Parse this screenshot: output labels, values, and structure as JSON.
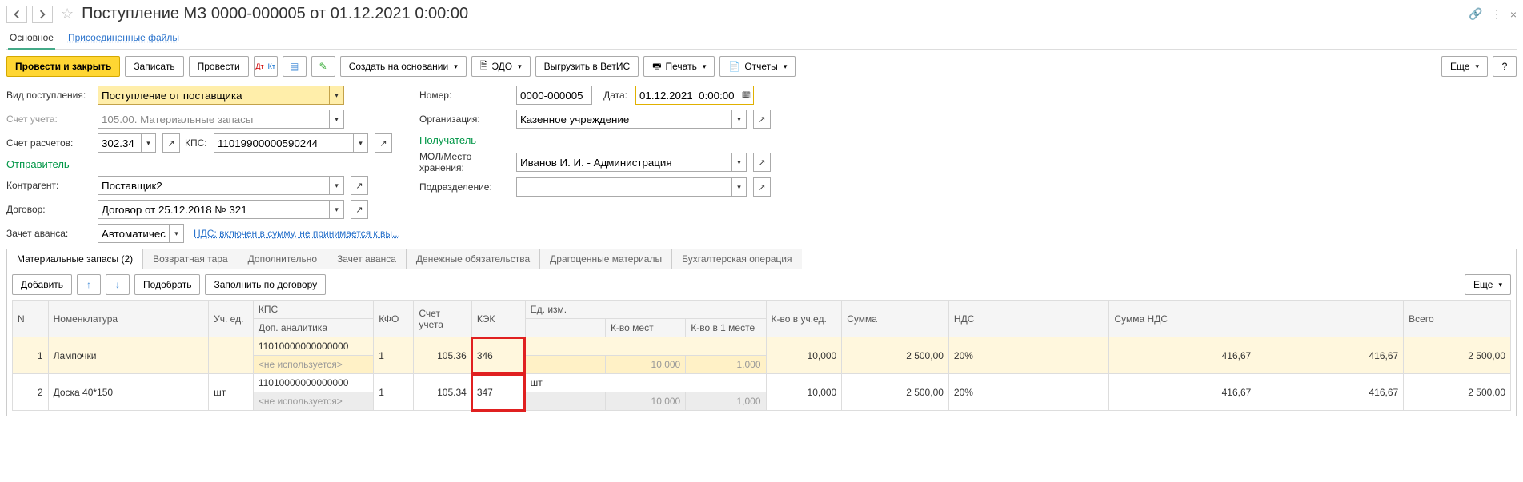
{
  "title": "Поступление МЗ 0000-000005 от 01.12.2021 0:00:00",
  "topTabs": {
    "main": "Основное",
    "files": "Присоединенные файлы"
  },
  "toolbar": {
    "postClose": "Провести и закрыть",
    "write": "Записать",
    "post": "Провести",
    "createFrom": "Создать на основании",
    "edo": "ЭДО",
    "uploadVetis": "Выгрузить в ВетИС",
    "print": "Печать",
    "reports": "Отчеты",
    "more": "Еще",
    "help": "?"
  },
  "labels": {
    "vidPost": "Вид поступления:",
    "schetUch": "Счет учета:",
    "schetRasch": "Счет расчетов:",
    "kps": "КПС:",
    "otprav": "Отправитель",
    "kontragent": "Контрагент:",
    "dogovor": "Договор:",
    "zachetAv": "Зачет аванса:",
    "nomer": "Номер:",
    "data": "Дата:",
    "org": "Организация:",
    "poluch": "Получатель",
    "mol": "МОЛ/Место хранения:",
    "podrazd": "Подразделение:"
  },
  "values": {
    "vidPost": "Поступление от поставщика",
    "schetUch": "105.00. Материальные запасы",
    "schetRasch": "302.34",
    "kps": "11019900000590244",
    "kontragent": "Поставщик2",
    "dogovor": "Договор от 25.12.2018 № 321",
    "zachetAv": "Автоматически",
    "nomer": "0000-000005",
    "data": "01.12.2021  0:00:00",
    "org": "Казенное учреждение",
    "mol": "Иванов И. И. - Администрация",
    "podrazd": "",
    "ndsLink": "НДС: включен в сумму, не принимается к вы..."
  },
  "detailTabs": {
    "mz": "Материальные запасы (2)",
    "tara": "Возвратная тара",
    "dop": "Дополнительно",
    "zachet": "Зачет аванса",
    "den": "Денежные обязательства",
    "drag": "Драгоценные материалы",
    "buh": "Бухгалтерская операция"
  },
  "tableToolbar": {
    "add": "Добавить",
    "podbor": "Подобрать",
    "fillDog": "Заполнить по договору",
    "more": "Еще"
  },
  "thead": {
    "n": "N",
    "nom": "Номенклатура",
    "uch": "Уч. ед.",
    "kps": "КПС",
    "kfo": "КФО",
    "su": "Счет учета",
    "kek": "КЭК",
    "ei": "Ед. изм.",
    "kvu": "К-во в уч.ед.",
    "sum": "Сумма",
    "nds": "НДС",
    "sumnds": "Сумма НДС",
    "vsego": "Всего",
    "dopan": "Доп. аналитика",
    "kvm": "К-во мест",
    "kv1": "К-во в 1 месте"
  },
  "rows": [
    {
      "n": "1",
      "nom": "Лампочки",
      "uch": "",
      "kps": "11010000000000000",
      "kfo": "1",
      "su": "105.36",
      "kek": "346",
      "ei": "",
      "kvu": "10,000",
      "sum": "2 500,00",
      "nds": "20%",
      "sumnds": "416,67",
      "sumnds2": "416,67",
      "vsego": "2 500,00",
      "dopan": "<не используется>",
      "kvm": "10,000",
      "kv1": "1,000"
    },
    {
      "n": "2",
      "nom": "Доска 40*150",
      "uch": "шт",
      "kps": "11010000000000000",
      "kfo": "1",
      "su": "105.34",
      "kek": "347",
      "ei": "шт",
      "kvu": "10,000",
      "sum": "2 500,00",
      "nds": "20%",
      "sumnds": "416,67",
      "sumnds2": "416,67",
      "vsego": "2 500,00",
      "dopan": "<не используется>",
      "kvm": "10,000",
      "kv1": "1,000"
    }
  ]
}
